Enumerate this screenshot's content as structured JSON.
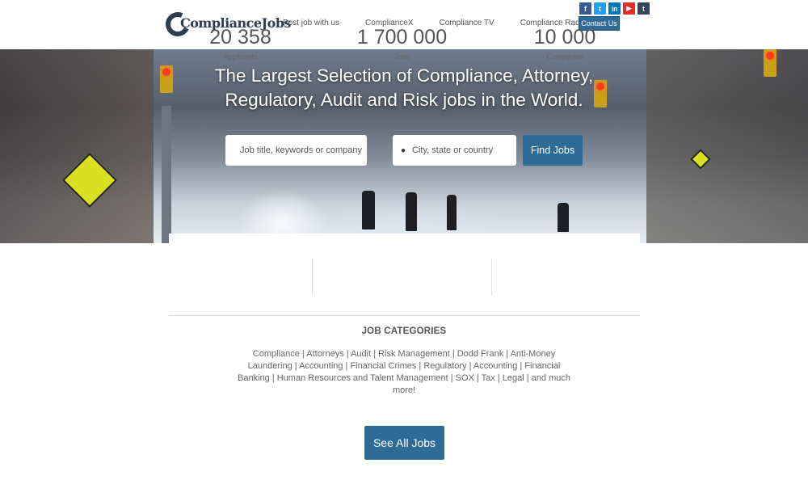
{
  "header": {
    "logo_text": "ComplianceJobs",
    "nav": [
      "Post job with us",
      "ComplianceX",
      "Compliance TV",
      "Compliance Radio"
    ],
    "social_icons": [
      {
        "name": "facebook-icon",
        "glyph": "f",
        "color": "#3b5998"
      },
      {
        "name": "twitter-icon",
        "glyph": "t",
        "color": "#1da1f2"
      },
      {
        "name": "linkedin-icon",
        "glyph": "in",
        "color": "#0077b5"
      },
      {
        "name": "youtube-icon",
        "glyph": "▶",
        "color": "#e52d27"
      },
      {
        "name": "tumblr-icon",
        "glyph": "t",
        "color": "#35465c"
      }
    ],
    "contact_label": "Contact Us"
  },
  "hero": {
    "headline_line1": "The Largest Selection of Compliance, Attorney,",
    "headline_line2": "Regulatory, Audit and Risk jobs in the World.",
    "job_placeholder": "Job title, keywords or company",
    "location_placeholder": "City, state or country",
    "find_label": "Find Jobs"
  },
  "stats": [
    {
      "value": "20 358",
      "label": "Applicants"
    },
    {
      "value": "1 700 000",
      "label": "Jobs"
    },
    {
      "value": "10 000",
      "label": "Companies"
    }
  ],
  "categories": {
    "title": "JOB CATEGORIES",
    "text": "Compliance | Attorneys | Audit | Risk Management | Dodd Frank | Anti-Money Laundering | Accounting | Financial Crimes | Regulatory | Accounting | Financial Banking | Human Resources and Talent Management | SOX | Tax | Legal | and much more!"
  },
  "see_all_label": "See All Jobs",
  "colors": {
    "accent": "#2e6b96",
    "text": "#555555"
  }
}
